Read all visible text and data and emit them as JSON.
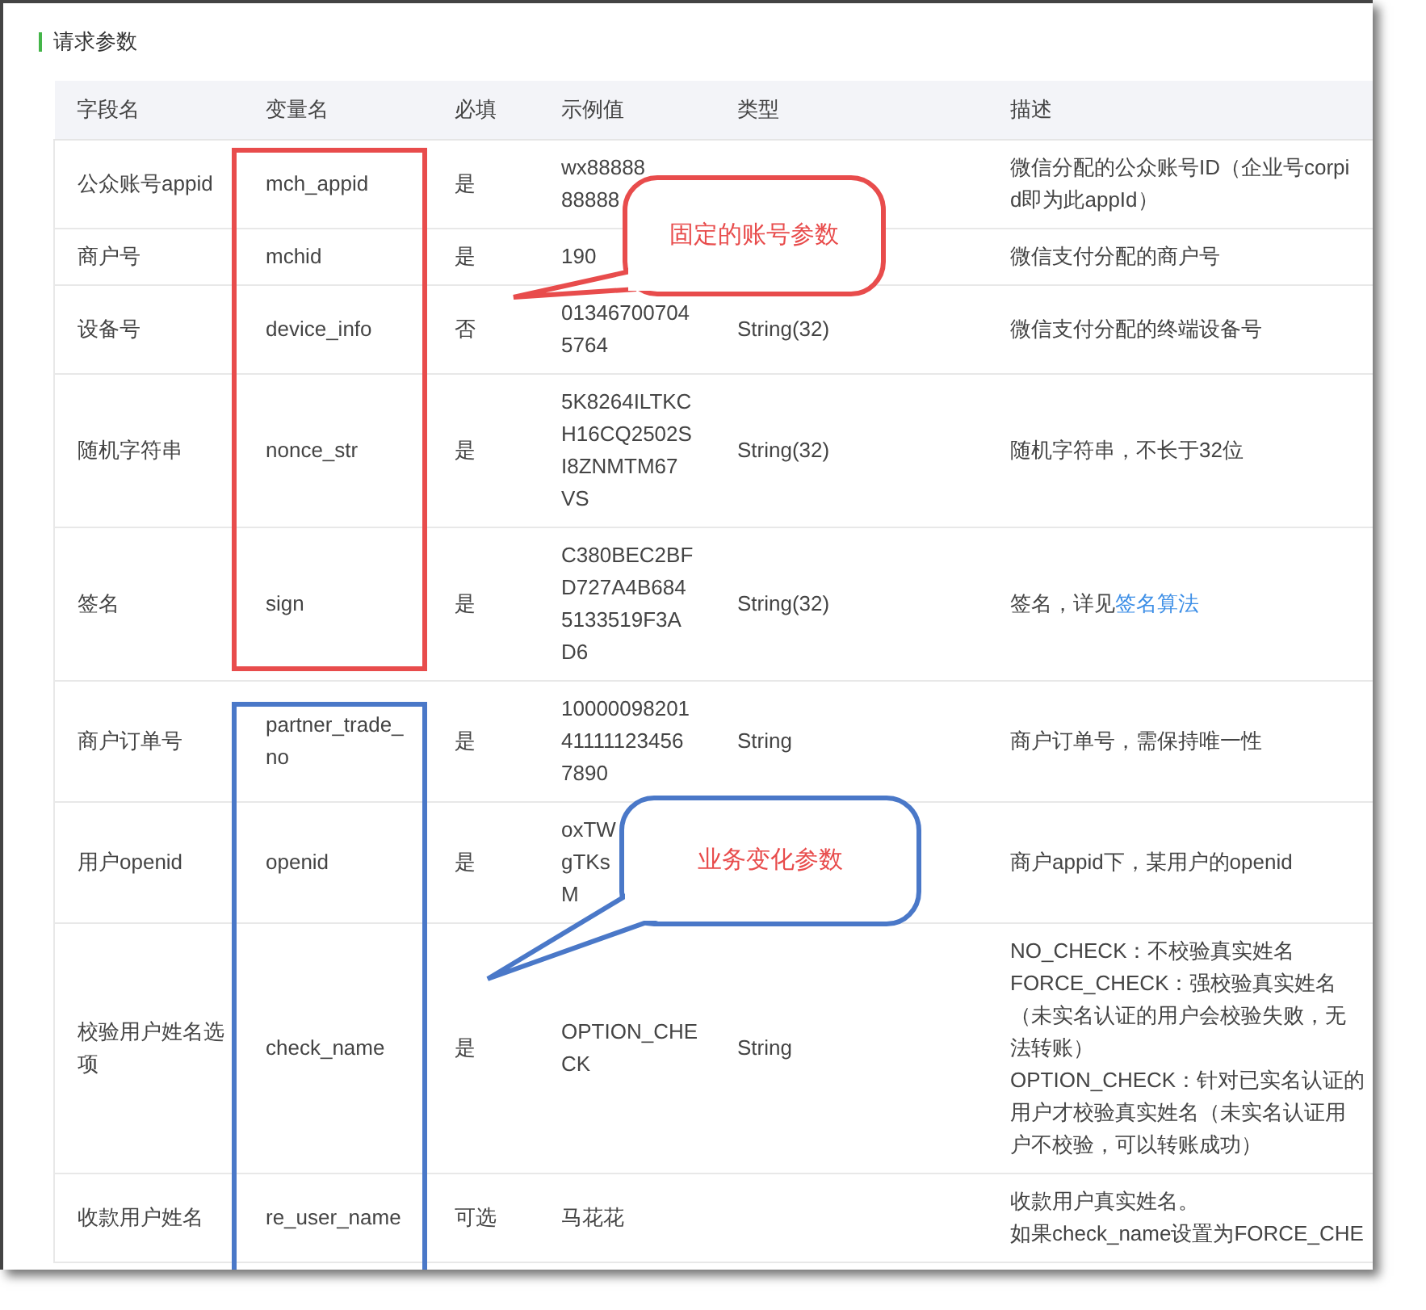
{
  "section_title": "请求参数",
  "table": {
    "columns": [
      "字段名",
      "变量名",
      "必填",
      "示例值",
      "类型",
      "描述"
    ],
    "rows": [
      {
        "cells": [
          [
            "公众账号appid"
          ],
          [
            "mch_appid"
          ],
          [
            "是"
          ],
          [
            "wx88888",
            "88888"
          ],
          [],
          [
            "微信分配的公众账号ID（企业号corpi",
            "d即为此appId）"
          ]
        ]
      },
      {
        "cells": [
          [
            "商户号"
          ],
          [
            "mchid"
          ],
          [
            "是"
          ],
          [
            "190"
          ],
          [],
          [
            "微信支付分配的商户号"
          ]
        ]
      },
      {
        "cells": [
          [
            "设备号"
          ],
          [
            "device_info"
          ],
          [
            "否"
          ],
          [
            "01346700704",
            "5764"
          ],
          [
            "String(32)"
          ],
          [
            "微信支付分配的终端设备号"
          ]
        ]
      },
      {
        "cells": [
          [
            "随机字符串"
          ],
          [
            "nonce_str"
          ],
          [
            "是"
          ],
          [
            "5K8264ILTKC",
            "H16CQ2502S",
            "I8ZNMTM67",
            "VS"
          ],
          [
            "String(32)"
          ],
          [
            "随机字符串，不长于32位"
          ]
        ]
      },
      {
        "cells": [
          [
            "签名"
          ],
          [
            "sign"
          ],
          [
            "是"
          ],
          [
            "C380BEC2BF",
            "D727A4B684",
            "5133519F3A",
            "D6"
          ],
          [
            "String(32)"
          ],
          [
            "签名，详见"
          ]
        ],
        "link": "签名算法"
      },
      {
        "cells": [
          [
            "商户订单号"
          ],
          [
            "partner_trade_",
            "no"
          ],
          [
            "是"
          ],
          [
            "10000098201",
            "41111123456",
            "7890"
          ],
          [
            "String"
          ],
          [
            "商户订单号，需保持唯一性"
          ]
        ]
      },
      {
        "cells": [
          [
            "用户openid"
          ],
          [
            "openid"
          ],
          [
            "是"
          ],
          [
            "oxTW",
            "gTKs",
            "M"
          ],
          [],
          [
            "商户appid下，某用户的openid"
          ]
        ]
      },
      {
        "cells": [
          [
            "校验用户姓名选",
            "项"
          ],
          [
            "check_name"
          ],
          [
            "是"
          ],
          [
            "OPTION_CHE",
            "CK"
          ],
          [
            "String"
          ],
          [
            "NO_CHECK：不校验真实姓名",
            "FORCE_CHECK：强校验真实姓名",
            "（未实名认证的用户会校验失败，无",
            "法转账）",
            "OPTION_CHECK：针对已实名认证的",
            "用户才校验真实姓名（未实名认证用",
            "户不校验，可以转账成功）"
          ]
        ]
      },
      {
        "cells": [
          [
            "收款用户姓名"
          ],
          [
            "re_user_name"
          ],
          [
            "可选"
          ],
          [
            "马花花"
          ],
          [],
          [
            "收款用户真实姓名。",
            "如果check_name设置为FORCE_CHE"
          ]
        ]
      }
    ]
  },
  "annotations": [
    {
      "kind": "frame",
      "color": "#e84c4c"
    },
    {
      "kind": "frame",
      "color": "#4a78c8"
    },
    {
      "kind": "callout",
      "color": "#e84c4c",
      "text": "固定的账号参数"
    },
    {
      "kind": "callout",
      "color": "#4a78c8",
      "text": "业务变化参数"
    }
  ]
}
